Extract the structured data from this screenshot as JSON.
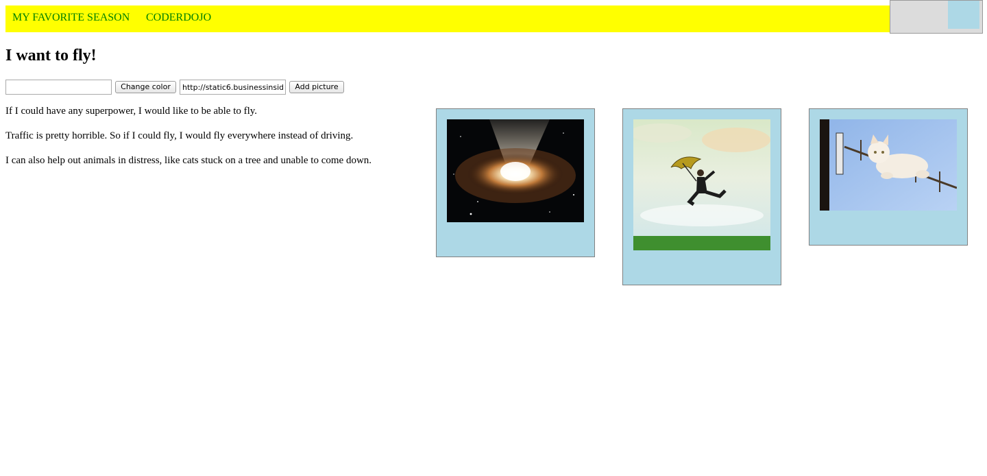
{
  "nav": {
    "links": [
      "MY FAVORITE SEASON",
      "CODERDOJO"
    ],
    "background": "#ffff00",
    "link_color": "#008000"
  },
  "page": {
    "title": "I want to fly!"
  },
  "controls": {
    "color_input_value": "",
    "change_color_label": "Change color",
    "url_input_value": "http://static6.businessinsid",
    "add_picture_label": "Add picture"
  },
  "paragraphs": [
    "If I could have any superpower, I would like to be able to fly.",
    "Traffic is pretty horrible. So if I could fly, I would fly everywhere instead of driving.",
    "I can also help out animals in distress, like cats stuck on a tree and unable to come down."
  ],
  "pictures": [
    {
      "icon": "galaxy-image"
    },
    {
      "icon": "flying-man-umbrella-image"
    },
    {
      "icon": "cat-on-antenna-image"
    }
  ],
  "colors": {
    "frame_background": "#add8e6",
    "corner_swatch": "#add8e6"
  }
}
